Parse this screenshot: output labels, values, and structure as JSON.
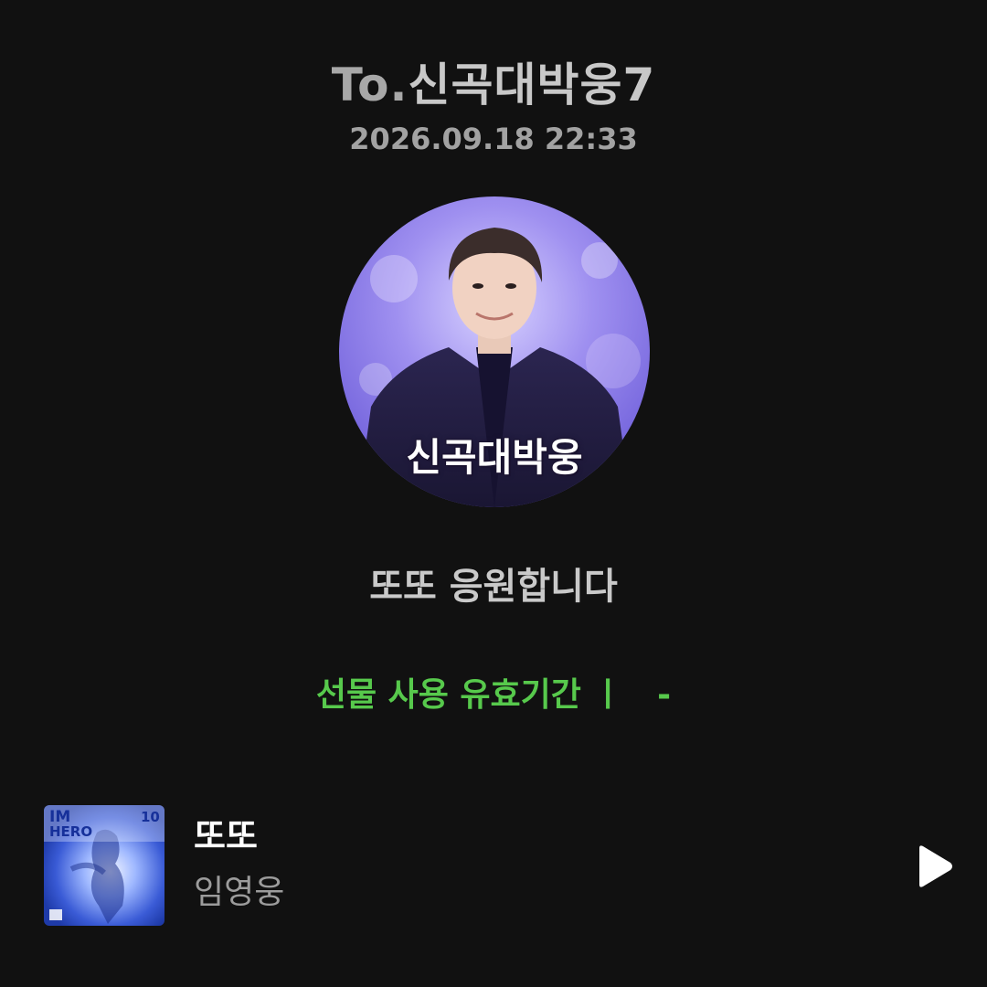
{
  "gift": {
    "to_prefix": "To.",
    "recipient_name": "신곡대박웅7",
    "sent_at": "2026.09.18 22:33",
    "avatar_caption": "신곡대박웅",
    "message": "또또 응원합니다",
    "validity_label": "선물 사용 유효기간 ㅣ",
    "validity_value": "-"
  },
  "track": {
    "title": "또또",
    "artist": "임영웅",
    "album_text": "IM HERO",
    "play_icon": "play-icon"
  },
  "colors": {
    "background": "#111111",
    "accent_green": "#57c94c",
    "title_text": "#ffffff",
    "muted_text": "#9c9c9c"
  }
}
